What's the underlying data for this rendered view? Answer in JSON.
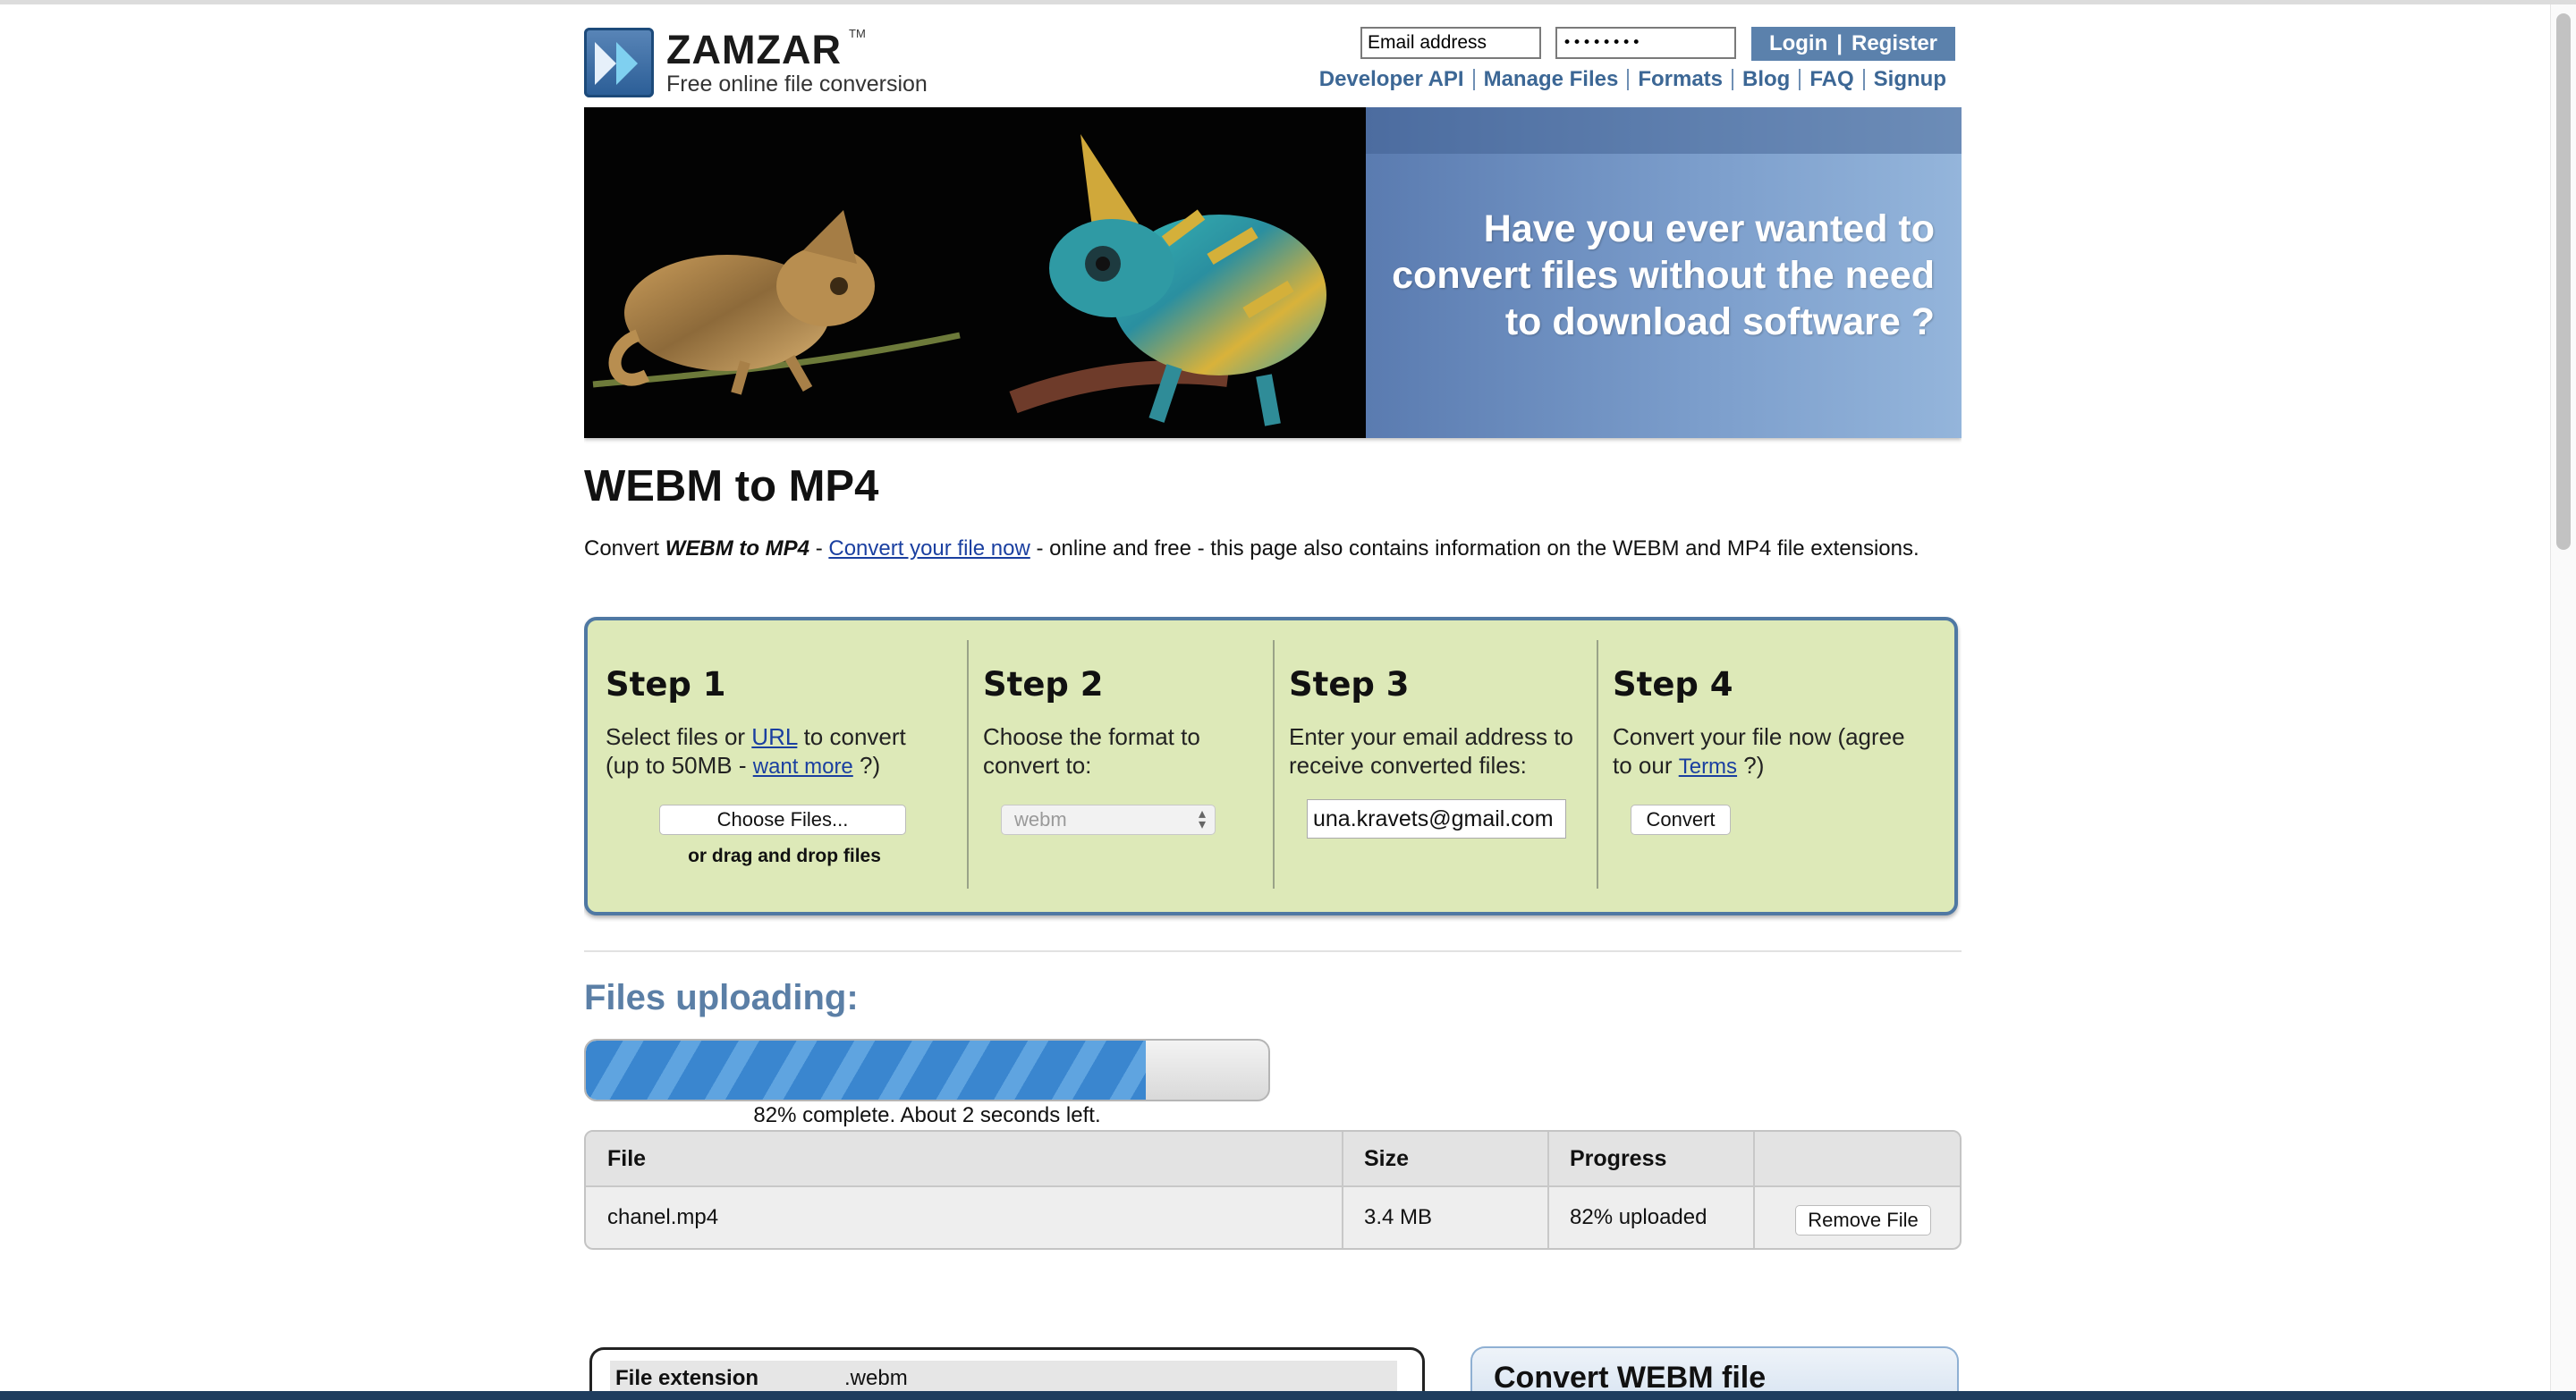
{
  "header": {
    "logo_text": "ZAMZAR",
    "logo_tm": "TM",
    "tagline": "Free online file conversion",
    "email_placeholder": "Email address",
    "password_value": "••••••••",
    "login_label": "Login",
    "login_sep": "|",
    "register_label": "Register",
    "nav": [
      "Developer API",
      "Manage Files",
      "Formats",
      "Blog",
      "FAQ",
      "Signup"
    ]
  },
  "banner": {
    "headline_line1": "Have you ever wanted to",
    "headline_line2": "convert files without the need",
    "headline_line3": "to download software ?"
  },
  "page": {
    "title": "WEBM to MP4",
    "intro_prefix": "Convert ",
    "intro_bold": "WEBM to MP4",
    "intro_dash": " - ",
    "intro_link": "Convert your file now",
    "intro_suffix": " - online and free - this page also contains information on the WEBM and MP4 file extensions."
  },
  "steps": {
    "step1": {
      "title": "Step 1",
      "text_a": "Select files or ",
      "url_link": "URL",
      "text_b": " to convert",
      "text_c": "(up to 50MB - ",
      "want_more_link": "want more",
      "text_d": " ?)",
      "choose_files_label": "Choose Files...",
      "drag_note": "or drag and drop files"
    },
    "step2": {
      "title": "Step 2",
      "text_a": "Choose the format to",
      "text_b": "convert to:",
      "selected_format": "webm"
    },
    "step3": {
      "title": "Step 3",
      "text_a": "Enter your email address to",
      "text_b": "receive converted files:",
      "email_value": "una.kravets@gmail.com"
    },
    "step4": {
      "title": "Step 4",
      "text_a": "Convert your file now (agree",
      "text_b": "to our ",
      "terms_link": "Terms",
      "text_c": " ?)",
      "convert_label": "Convert"
    }
  },
  "upload": {
    "title": "Files uploading:",
    "progress_fraction": 0.82,
    "progress_text": "82% complete. About 2 seconds left.",
    "table": {
      "headers": [
        "File",
        "Size",
        "Progress",
        ""
      ],
      "rows": [
        {
          "file": "chanel.mp4",
          "size": "3.4 MB",
          "progress": "82% uploaded",
          "action": "Remove File"
        }
      ]
    }
  },
  "bottom": {
    "ext_label": "File extension",
    "ext_value": ".webm",
    "convert_box_title": "Convert WEBM file"
  },
  "colors": {
    "accent_blue": "#3c6795",
    "steps_bg": "#dde9b8",
    "steps_border": "#4f78a3",
    "progress_blue": "#3a86cf"
  }
}
